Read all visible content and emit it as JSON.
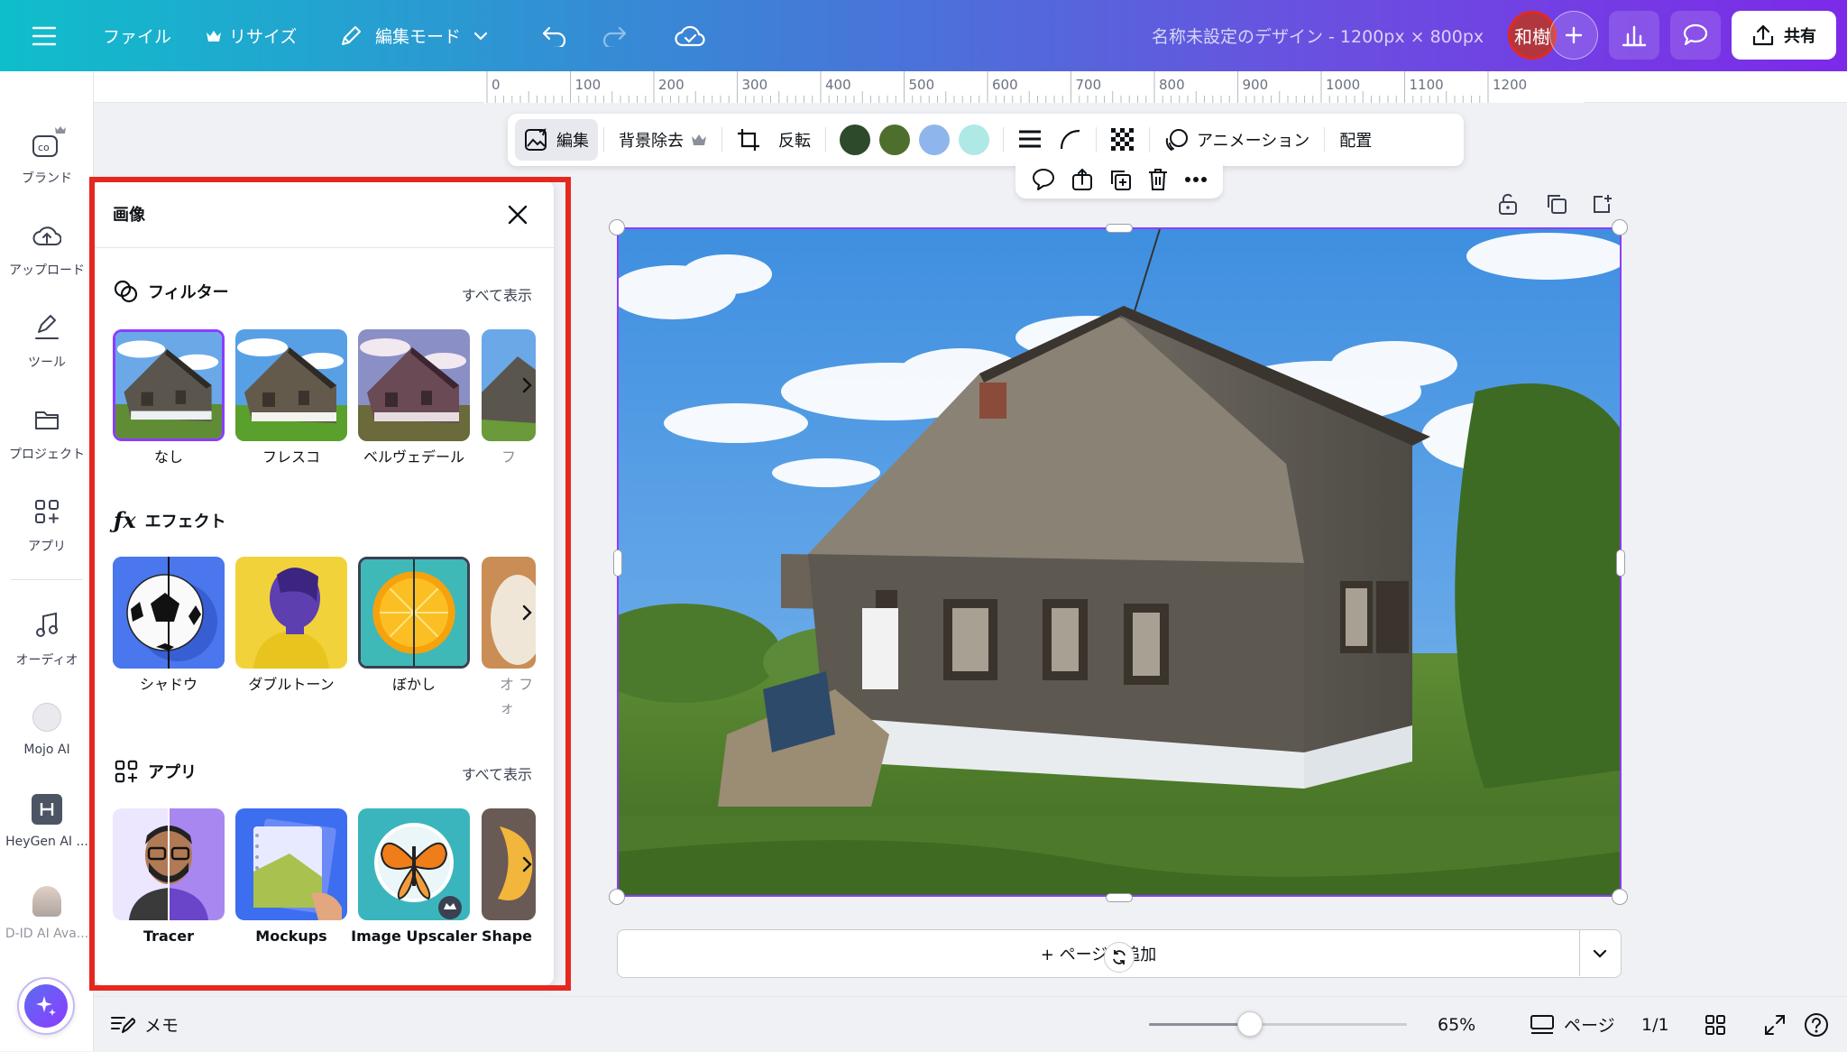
{
  "topbar": {
    "file_label": "ファイル",
    "resize_label": "リサイズ",
    "edit_mode_label": "編集モード",
    "doc_title": "名称未設定のデザイン - 1200px × 800px",
    "avatar_text": "和樹",
    "share_label": "共有"
  },
  "rail": {
    "items": [
      {
        "label": "ブランド"
      },
      {
        "label": "アップロード"
      },
      {
        "label": "ツール"
      },
      {
        "label": "プロジェクト"
      },
      {
        "label": "アプリ"
      },
      {
        "label": "オーディオ"
      },
      {
        "label": "Mojo AI"
      },
      {
        "label": "HeyGen AI ..."
      },
      {
        "label": "D-ID AI Ava..."
      }
    ]
  },
  "ruler": {
    "labels": [
      "0",
      "100",
      "200",
      "300",
      "400",
      "500",
      "600",
      "700",
      "800",
      "900",
      "1000",
      "1100",
      "1200"
    ]
  },
  "context_toolbar": {
    "edit_label": "編集",
    "bg_remove_label": "背景除去",
    "flip_label": "反転",
    "animation_label": "アニメーション",
    "position_label": "配置",
    "swatches": [
      "#2d4a2b",
      "#4e6e2e",
      "#8fb6ec",
      "#aee9e6"
    ]
  },
  "panel": {
    "title": "画像",
    "filters": {
      "title": "フィルター",
      "see_all": "すべて表示",
      "items": [
        {
          "label": "なし"
        },
        {
          "label": "フレスコ"
        },
        {
          "label": "ベルヴェデール"
        },
        {
          "label": "フ"
        }
      ]
    },
    "effects": {
      "title": "エフェクト",
      "items": [
        {
          "label": "シャドウ"
        },
        {
          "label": "ダブルトーン"
        },
        {
          "label": "ぼかし"
        },
        {
          "label": "オ フォ"
        }
      ]
    },
    "apps": {
      "title": "アプリ",
      "see_all": "すべて表示",
      "items": [
        {
          "label": "Tracer"
        },
        {
          "label": "Mockups"
        },
        {
          "label": "Image Upscaler"
        },
        {
          "label": "Shape"
        }
      ]
    }
  },
  "canvas": {
    "add_page_label": "+ ページを追加"
  },
  "bottombar": {
    "notes_label": "メモ",
    "zoom_value": 0.65,
    "zoom_label": "65%",
    "pages_label": "ページ",
    "page_count": "1/1"
  }
}
